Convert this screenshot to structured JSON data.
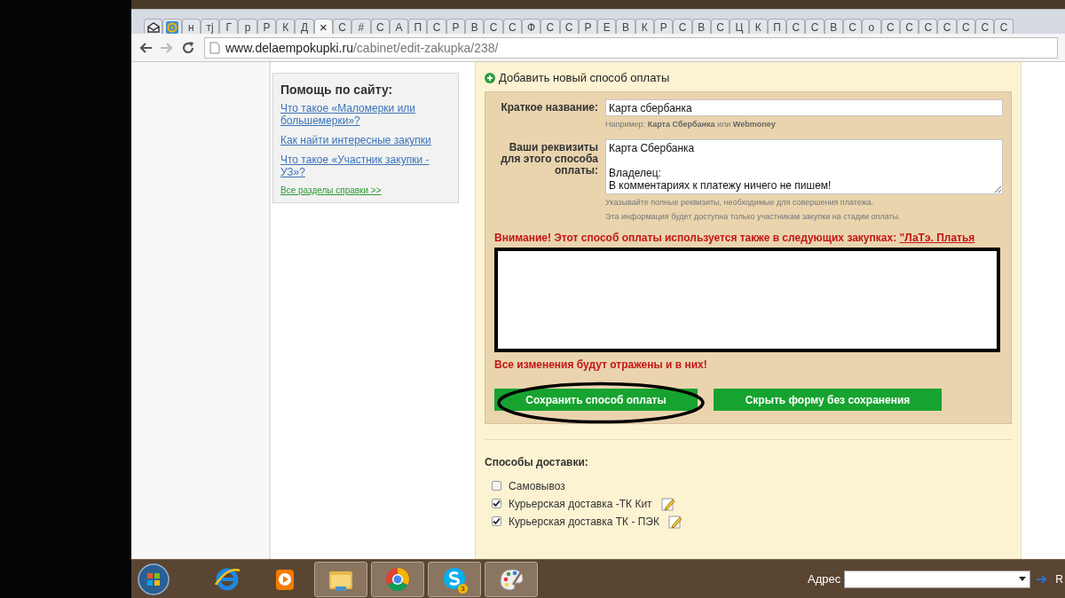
{
  "browser": {
    "tabs": [
      {
        "kind": "icon",
        "selected": false
      },
      {
        "kind": "icon",
        "selected": false
      },
      {
        "kind": "text",
        "label": "н",
        "selected": false
      },
      {
        "kind": "text",
        "label": "тј",
        "selected": false
      },
      {
        "kind": "text",
        "label": "Г",
        "selected": false
      },
      {
        "kind": "text",
        "label": "р",
        "selected": false
      },
      {
        "kind": "text",
        "label": "Р",
        "selected": false
      },
      {
        "kind": "text",
        "label": "К",
        "selected": false
      },
      {
        "kind": "text",
        "label": "Д",
        "selected": false
      },
      {
        "kind": "close",
        "label": "×",
        "selected": true
      },
      {
        "kind": "text",
        "label": "С",
        "selected": false
      },
      {
        "kind": "text",
        "label": "#",
        "selected": false
      },
      {
        "kind": "text",
        "label": "С",
        "selected": false
      },
      {
        "kind": "text",
        "label": "А",
        "selected": false
      },
      {
        "kind": "text",
        "label": "П",
        "selected": false
      },
      {
        "kind": "text",
        "label": "С",
        "selected": false
      },
      {
        "kind": "text",
        "label": "Р",
        "selected": false
      },
      {
        "kind": "text",
        "label": "В",
        "selected": false
      },
      {
        "kind": "text",
        "label": "С",
        "selected": false
      },
      {
        "kind": "text",
        "label": "С",
        "selected": false
      },
      {
        "kind": "text",
        "label": "Ф",
        "selected": false
      },
      {
        "kind": "text",
        "label": "С",
        "selected": false
      },
      {
        "kind": "text",
        "label": "С",
        "selected": false
      },
      {
        "kind": "text",
        "label": "Р",
        "selected": false
      },
      {
        "kind": "text",
        "label": "Е",
        "selected": false
      },
      {
        "kind": "text",
        "label": "В",
        "selected": false
      },
      {
        "kind": "text",
        "label": "К",
        "selected": false
      },
      {
        "kind": "text",
        "label": "Р",
        "selected": false
      },
      {
        "kind": "text",
        "label": "С",
        "selected": false
      },
      {
        "kind": "text",
        "label": "В",
        "selected": false
      },
      {
        "kind": "text",
        "label": "С",
        "selected": false
      },
      {
        "kind": "text",
        "label": "Ц",
        "selected": false
      },
      {
        "kind": "text",
        "label": "К",
        "selected": false
      },
      {
        "kind": "text",
        "label": "П",
        "selected": false
      },
      {
        "kind": "text",
        "label": "С",
        "selected": false
      },
      {
        "kind": "text",
        "label": "С",
        "selected": false
      },
      {
        "kind": "text",
        "label": "В",
        "selected": false
      },
      {
        "kind": "text",
        "label": "С",
        "selected": false
      },
      {
        "kind": "text",
        "label": "о",
        "selected": false
      },
      {
        "kind": "text",
        "label": "С",
        "selected": false
      },
      {
        "kind": "text",
        "label": "С",
        "selected": false
      },
      {
        "kind": "text",
        "label": "С",
        "selected": false
      },
      {
        "kind": "text",
        "label": "С",
        "selected": false
      },
      {
        "kind": "text",
        "label": "С",
        "selected": false
      },
      {
        "kind": "text",
        "label": "С",
        "selected": false
      },
      {
        "kind": "text",
        "label": "С",
        "selected": false
      }
    ],
    "url": {
      "host": "www.delaempokupki.ru",
      "path": "/cabinet/edit-zakupka/238/"
    }
  },
  "help": {
    "title": "Помощь по сайту:",
    "links": [
      "Что такое «Маломерки или большемерки»?",
      "Как найти интересные закупки",
      "Что такое «Участник закупки - УЗ»?"
    ],
    "all_link": "Все разделы справки >>"
  },
  "payment_form": {
    "add_link": "Добавить новый способ оплаты",
    "name_label": "Краткое название:",
    "name_value": "Карта сбербанка",
    "name_hint": "Например: **Карта Сбербанка** или **Webmoney**",
    "details_label": "Ваши реквизиты для этого способа оплаты:",
    "details_value": "Карта Сбербанка\n\nВладелец:\nВ комментариях к платежу ничего не пишем!",
    "details_hints": [
      "Указывайте полные реквизиты, необходимые для совершения платежа.",
      "Эта информация будет доступна только участникам закупки на стадии оплаты."
    ],
    "warning": "Внимание! Этот способ оплаты используется также в следующих закупках: ",
    "warning_link": "\"ЛаТэ. Платья",
    "warning_end": "Все изменения будут отражены и в них!",
    "buttons": [
      {
        "label": "Сохранить способ оплаты",
        "circled": true
      },
      {
        "label": "Скрыть форму без сохранения",
        "circled": false
      }
    ]
  },
  "delivery": {
    "title": "Способы доставки:",
    "items": [
      {
        "label": "Самовывоз",
        "checked": false,
        "editable": false
      },
      {
        "label": "Курьерская доставка -ТК Кит",
        "checked": true,
        "editable": true
      },
      {
        "label": "Курьерская доставка ТК - ПЭК",
        "checked": true,
        "editable": true
      }
    ]
  },
  "taskbar": {
    "apps": [
      {
        "active": false
      },
      {
        "active": false
      },
      {
        "active": true
      },
      {
        "active": true
      },
      {
        "active": true,
        "badge": "3"
      },
      {
        "active": true
      }
    ],
    "address_label": "Адрес",
    "edge_text": "R"
  }
}
